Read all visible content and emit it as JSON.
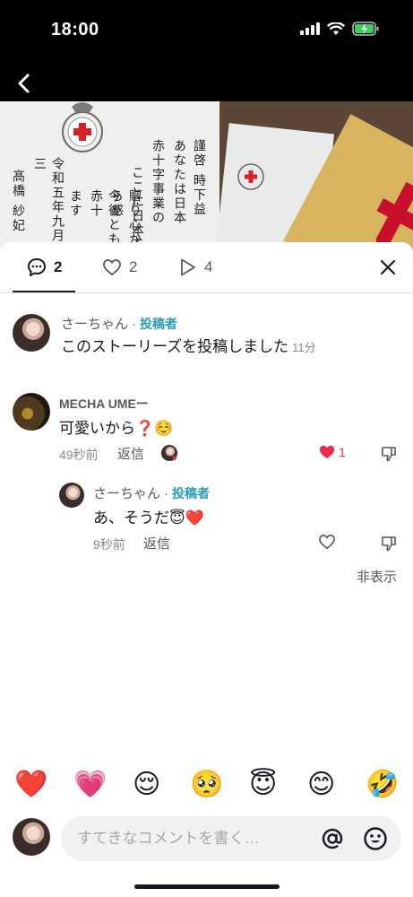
{
  "status": {
    "time": "18:00"
  },
  "hero": {
    "lines": [
      "謹啓 時下益",
      "あなたは日本",
      "赤十字事業の",
      "ここに日本赤",
      "贈り心から感",
      "今後とも赤十",
      "ます"
    ],
    "signature": [
      "令和五年九月三",
      "髙橋 紗妃"
    ]
  },
  "tabs": [
    {
      "icon": "comment-icon",
      "count": "2"
    },
    {
      "icon": "heart-outline-icon",
      "count": "2"
    },
    {
      "icon": "play-icon",
      "count": "4"
    }
  ],
  "comments": [
    {
      "author": "さーちゃん",
      "separator": "·",
      "role": "投稿者",
      "text": "このストーリーズを投稿しました",
      "time": "11分"
    },
    {
      "author": "MECHA UMEー",
      "text": "可愛いから❓☺️",
      "time": "49秒前",
      "reply_label": "返信",
      "like_count": "1"
    },
    {
      "author": "さーちゃん",
      "separator": "·",
      "role": "投稿者",
      "text": "あ、そうだ😇❤️",
      "time": "9秒前",
      "reply_label": "返信"
    }
  ],
  "hide_label": "非表示",
  "emoji_bar": [
    "❤️",
    "💗",
    "😌",
    "🥺",
    "😇",
    "😊",
    "🤣"
  ],
  "composer": {
    "placeholder": "すてきなコメントを書く…"
  },
  "colors": {
    "accent": "#2a9cb6",
    "like": "#f02a4d"
  }
}
